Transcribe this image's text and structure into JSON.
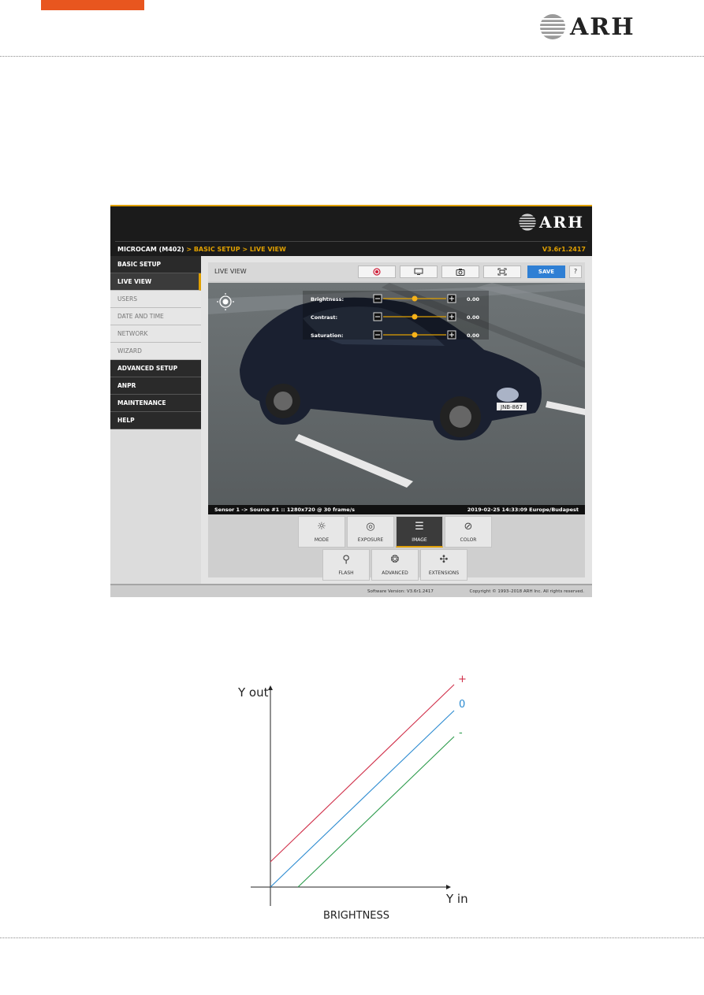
{
  "document": {
    "brand": "ARH"
  },
  "screenshot": {
    "brand": "ARH",
    "breadcrumb": {
      "device": "MICROCAM (M402)",
      "path": " > BASIC SETUP > LIVE VIEW"
    },
    "version": "V3.6r1.2417",
    "sidebar": [
      {
        "label": "BASIC SETUP",
        "style": "dark"
      },
      {
        "label": "LIVE VIEW",
        "style": "active"
      },
      {
        "label": "USERS",
        "style": "light"
      },
      {
        "label": "DATE AND TIME",
        "style": "light"
      },
      {
        "label": "NETWORK",
        "style": "light"
      },
      {
        "label": "WIZARD",
        "style": "light"
      },
      {
        "label": "ADVANCED SETUP",
        "style": "dark"
      },
      {
        "label": "ANPR",
        "style": "dark"
      },
      {
        "label": "MAINTENANCE",
        "style": "dark"
      },
      {
        "label": "HELP",
        "style": "dark"
      }
    ],
    "live_view": {
      "title": "LIVE VIEW",
      "save_label": "SAVE",
      "help_label": "?",
      "toolbar_icons": [
        "record-icon",
        "overlay-icon",
        "camera-icon",
        "fullscreen-icon"
      ],
      "plate_text": "JNB-867",
      "controls": [
        {
          "label": "Brightness:",
          "value": "0.00"
        },
        {
          "label": "Contrast:",
          "value": "0.00"
        },
        {
          "label": "Saturation:",
          "value": "0.00"
        }
      ],
      "sensor_info": "Sensor 1 -> Source #1 :: 1280x720 @ 30 frame/s",
      "timestamp": "2019-02-25 14:33:09 Europe/Budapest",
      "tiles_row1": [
        {
          "label": "MODE",
          "icon": "mode-icon",
          "glyph": "☼"
        },
        {
          "label": "EXPOSURE",
          "icon": "aperture-icon",
          "glyph": "◎"
        },
        {
          "label": "IMAGE",
          "icon": "sliders-icon",
          "glyph": "☰",
          "selected": true
        },
        {
          "label": "COLOR",
          "icon": "palette-icon",
          "glyph": "⊘"
        }
      ],
      "tiles_row2": [
        {
          "label": "FLASH",
          "icon": "flash-icon",
          "glyph": "⚲"
        },
        {
          "label": "ADVANCED",
          "icon": "brain-icon",
          "glyph": "❂"
        },
        {
          "label": "EXTENSIONS",
          "icon": "puzzle-icon",
          "glyph": "✣"
        }
      ]
    },
    "footer": {
      "software_version": "Software Version:   V3.6r1.2417",
      "copyright": "Copyright © 1993–2018 ARH Inc. All rights reserved."
    }
  },
  "graph": {
    "y_label": "Y out",
    "x_label": "Y in",
    "caption": "BRIGHTNESS",
    "lines": [
      {
        "label": "+",
        "color": "#d0304a"
      },
      {
        "label": "0",
        "color": "#2a8ad0"
      },
      {
        "label": "-",
        "color": "#2a9a4a"
      }
    ]
  }
}
